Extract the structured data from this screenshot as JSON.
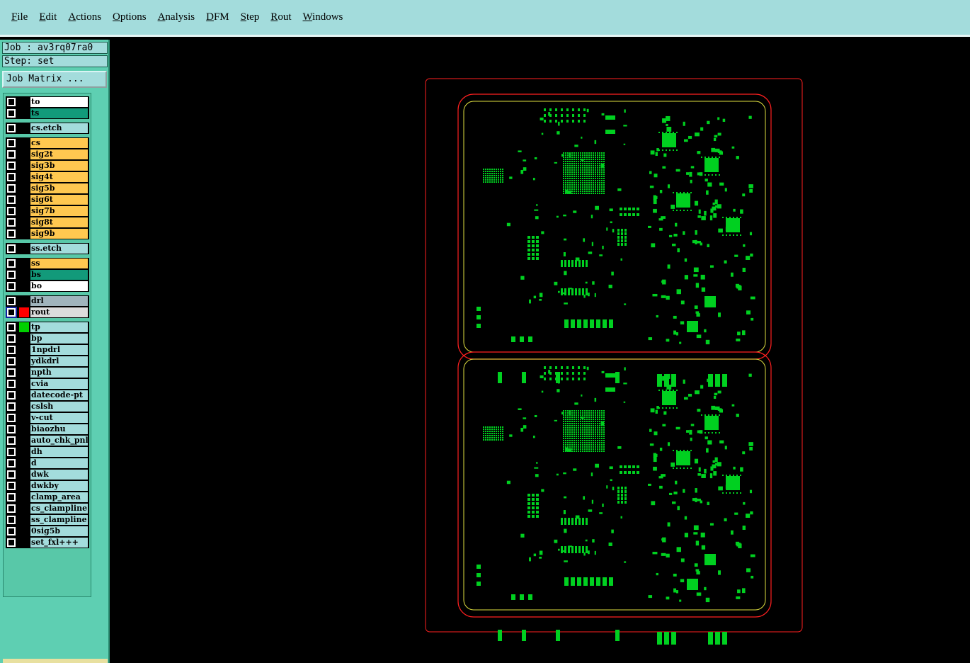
{
  "menu": [
    "File",
    "Edit",
    "Actions",
    "Options",
    "Analysis",
    "DFM",
    "Step",
    "Rout",
    "Windows"
  ],
  "job_label": "Job : av3rq07ra0",
  "step_label": "Step: set",
  "job_matrix_button": "Job Matrix ...",
  "layers": [
    {
      "name": "to",
      "color": "#ffffff",
      "group": 0
    },
    {
      "name": "ts",
      "color": "#129a7a",
      "group": 0
    },
    {
      "name": "cs.etch",
      "color": "#a3dcdc",
      "group": 1
    },
    {
      "name": "cs",
      "color": "#ffc850",
      "group": 2
    },
    {
      "name": "sig2t",
      "color": "#ffc850",
      "group": 2
    },
    {
      "name": "sig3b",
      "color": "#ffc850",
      "group": 2
    },
    {
      "name": "sig4t",
      "color": "#ffc850",
      "group": 2
    },
    {
      "name": "sig5b",
      "color": "#ffc850",
      "group": 2
    },
    {
      "name": "sig6t",
      "color": "#ffc850",
      "group": 2
    },
    {
      "name": "sig7b",
      "color": "#ffc850",
      "group": 2
    },
    {
      "name": "sig8t",
      "color": "#ffc850",
      "group": 2
    },
    {
      "name": "sig9b",
      "color": "#ffc850",
      "group": 2
    },
    {
      "name": "ss.etch",
      "color": "#a3dcdc",
      "group": 3
    },
    {
      "name": "ss",
      "color": "#ffc850",
      "group": 4
    },
    {
      "name": "bs",
      "color": "#129a7a",
      "group": 4
    },
    {
      "name": "bo",
      "color": "#ffffff",
      "group": 4
    },
    {
      "name": "drl",
      "color": "#a0b4bc",
      "group": 5
    },
    {
      "name": "rout",
      "color": "#dcdcdc",
      "group": 5,
      "active": true,
      "swatch": "#ff0000"
    },
    {
      "name": "tp",
      "color": "#a3dcdc",
      "group": 6,
      "swatch": "#00d000"
    },
    {
      "name": "bp",
      "color": "#a3dcdc",
      "group": 6
    },
    {
      "name": "1npdrl",
      "color": "#a3dcdc",
      "group": 6
    },
    {
      "name": "ydkdrl",
      "color": "#a3dcdc",
      "group": 6
    },
    {
      "name": "npth",
      "color": "#a3dcdc",
      "group": 6
    },
    {
      "name": "cvia",
      "color": "#a3dcdc",
      "group": 6
    },
    {
      "name": "datecode-pt",
      "color": "#a3dcdc",
      "group": 6
    },
    {
      "name": "cslsh",
      "color": "#a3dcdc",
      "group": 6
    },
    {
      "name": "v-cut",
      "color": "#a3dcdc",
      "group": 6
    },
    {
      "name": "biaozhu",
      "color": "#a3dcdc",
      "group": 6
    },
    {
      "name": "auto_chk_pnl",
      "color": "#a3dcdc",
      "group": 6
    },
    {
      "name": "dh",
      "color": "#a3dcdc",
      "group": 6
    },
    {
      "name": "d",
      "color": "#a3dcdc",
      "group": 6
    },
    {
      "name": "dwk",
      "color": "#a3dcdc",
      "group": 6
    },
    {
      "name": "dwkby",
      "color": "#a3dcdc",
      "group": 6
    },
    {
      "name": "clamp_area",
      "color": "#a3dcdc",
      "group": 6
    },
    {
      "name": "cs_clampline",
      "color": "#a3dcdc",
      "group": 6
    },
    {
      "name": "ss_clampline",
      "color": "#a3dcdc",
      "group": 6
    },
    {
      "name": "0sig5b",
      "color": "#a3dcdc",
      "group": 6
    },
    {
      "name": "set_fxl+++",
      "color": "#a3dcdc",
      "group": 6
    }
  ],
  "colors": {
    "rout": "#ff2020",
    "profile": "#e0e040",
    "pads": "#00d020"
  }
}
